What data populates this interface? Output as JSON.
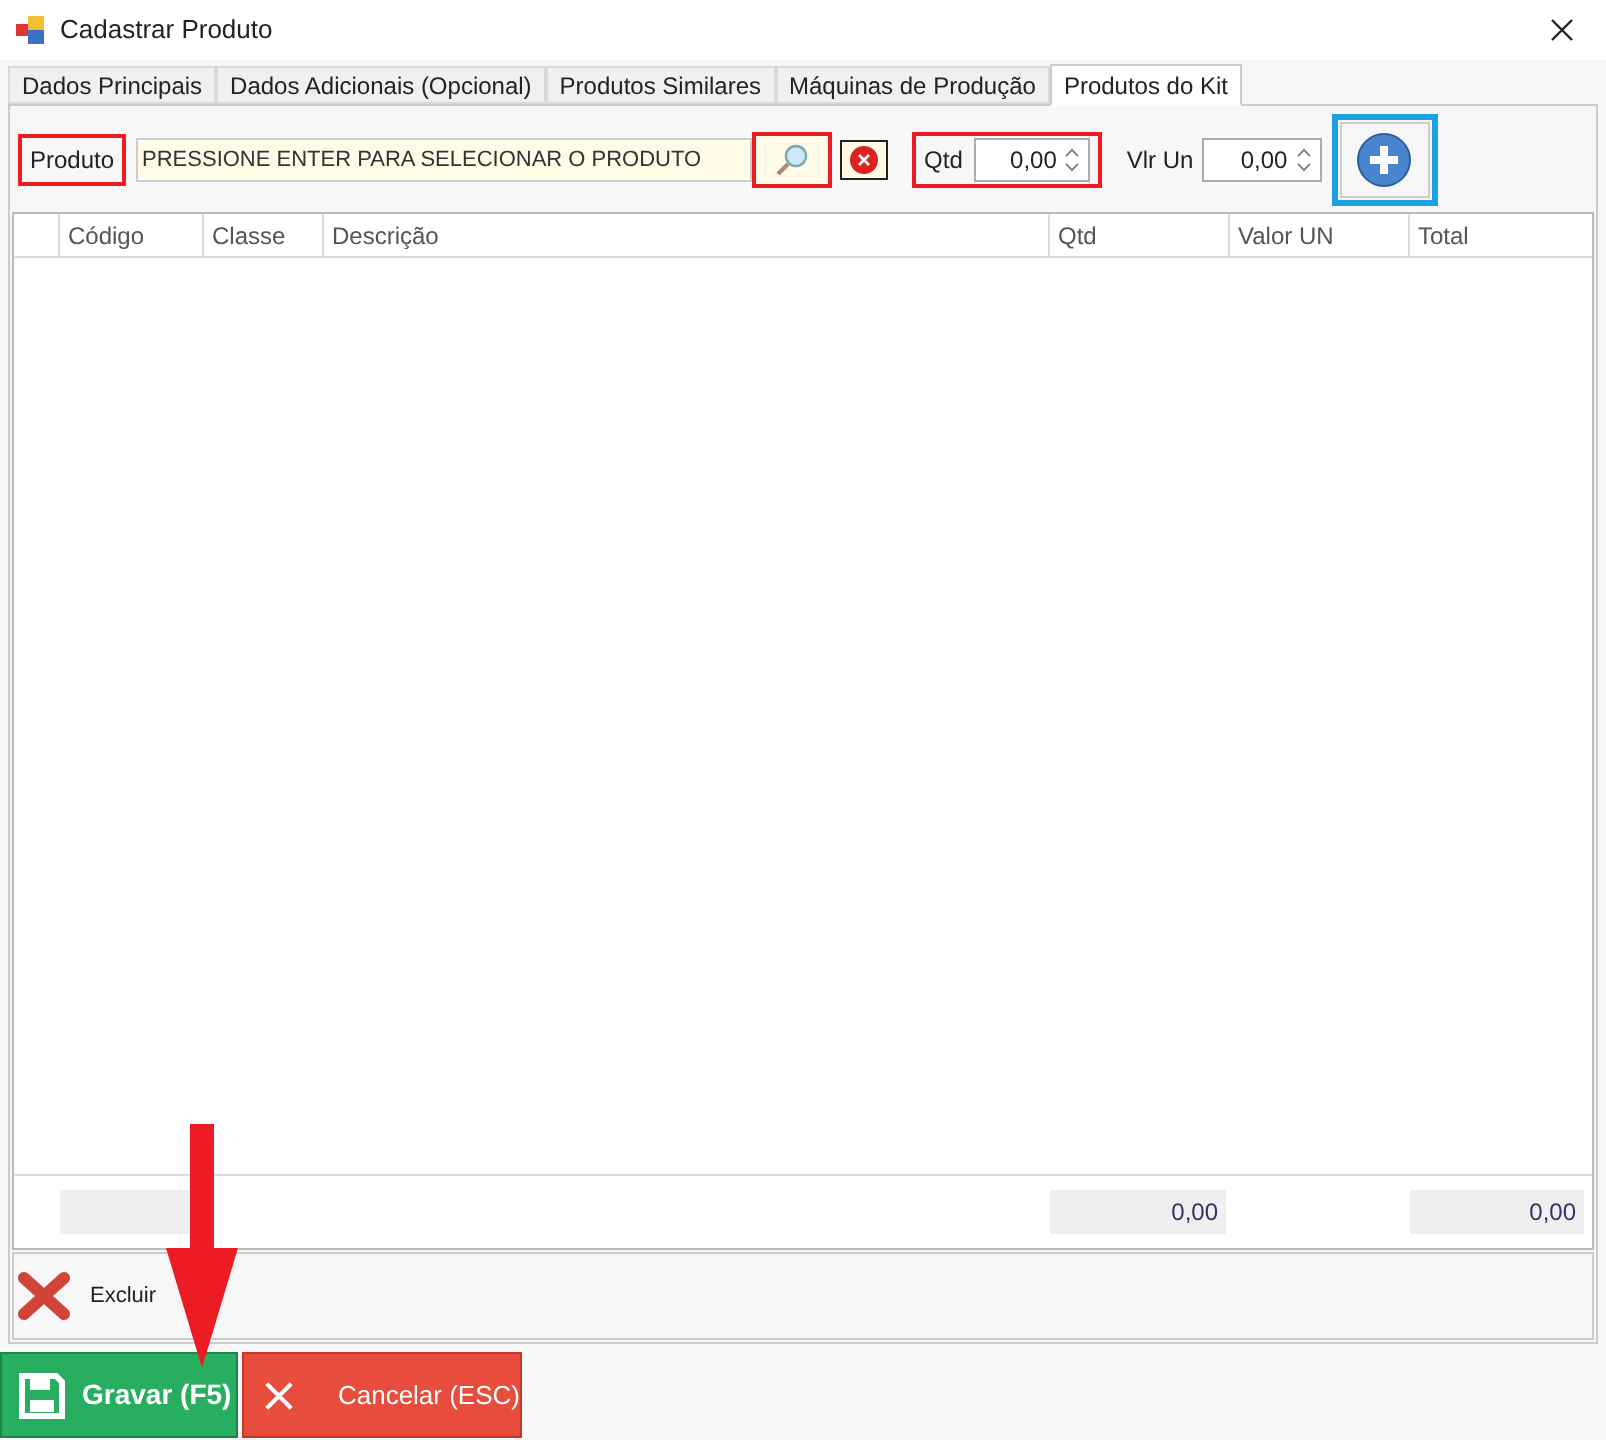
{
  "window": {
    "title": "Cadastrar Produto"
  },
  "tabs": [
    {
      "label": "Dados Principais",
      "selected": false
    },
    {
      "label": "Dados Adicionais (Opcional)",
      "selected": false
    },
    {
      "label": "Produtos Similares",
      "selected": false
    },
    {
      "label": "Máquinas de Produção",
      "selected": false
    },
    {
      "label": "Produtos do Kit",
      "selected": true
    }
  ],
  "product": {
    "label": "Produto",
    "label_frame": {
      "color": "#ed1c24"
    },
    "placeholder": "PRESSIONE ENTER PARA SELECIONAR O PRODUTO",
    "search_frame": {
      "color": "#ed1c24"
    }
  },
  "qty": {
    "label": "Qtd",
    "value": "0,00",
    "frame": {
      "color": "#ed1c24"
    }
  },
  "unit_price": {
    "label": "Vlr Un",
    "value": "0,00"
  },
  "add_button": {
    "frame": {
      "color": "#1ba1e2"
    }
  },
  "table": {
    "columns": [
      "Código",
      "Classe",
      "Descrição",
      "Qtd",
      "Valor UN",
      "Total"
    ],
    "totals": {
      "qty": "0,00",
      "total": "0,00"
    }
  },
  "delete_button": {
    "label": "Excluir"
  },
  "buttons": [
    {
      "kind": "save",
      "label": "Gravar (F5)"
    },
    {
      "kind": "cancel",
      "label": "Cancelar (ESC)"
    }
  ],
  "arrow": {
    "color": "#ed1c24"
  }
}
